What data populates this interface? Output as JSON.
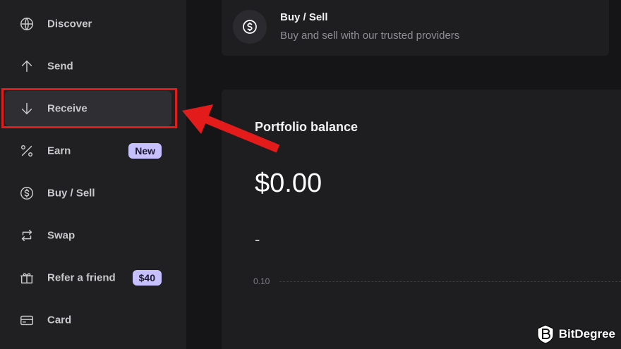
{
  "sidebar": {
    "items": [
      {
        "label": "Discover",
        "icon": "globe-icon"
      },
      {
        "label": "Send",
        "icon": "arrow-up-icon"
      },
      {
        "label": "Receive",
        "icon": "arrow-down-icon",
        "active": true
      },
      {
        "label": "Earn",
        "icon": "percent-icon",
        "badge": "New"
      },
      {
        "label": "Buy / Sell",
        "icon": "dollar-coin-icon"
      },
      {
        "label": "Swap",
        "icon": "swap-icon"
      },
      {
        "label": "Refer a friend",
        "icon": "gift-icon",
        "badge": "$40"
      },
      {
        "label": "Card",
        "icon": "card-icon"
      }
    ]
  },
  "buy_sell_card": {
    "icon": "dollar-coin-icon",
    "title": "Buy / Sell",
    "subtitle": "Buy and sell with our trusted providers"
  },
  "portfolio": {
    "title": "Portfolio balance",
    "balance": "$0.00",
    "change": "-",
    "y_tick": "0.10"
  },
  "annotation": {
    "highlight_color": "#e31b1b",
    "arrow_color": "#e31b1b"
  },
  "watermark": {
    "text": "BitDegree"
  },
  "colors": {
    "sidebar_bg": "#202023",
    "panel_bg": "#1e1e21",
    "badge_bg": "#c7c0ff"
  }
}
